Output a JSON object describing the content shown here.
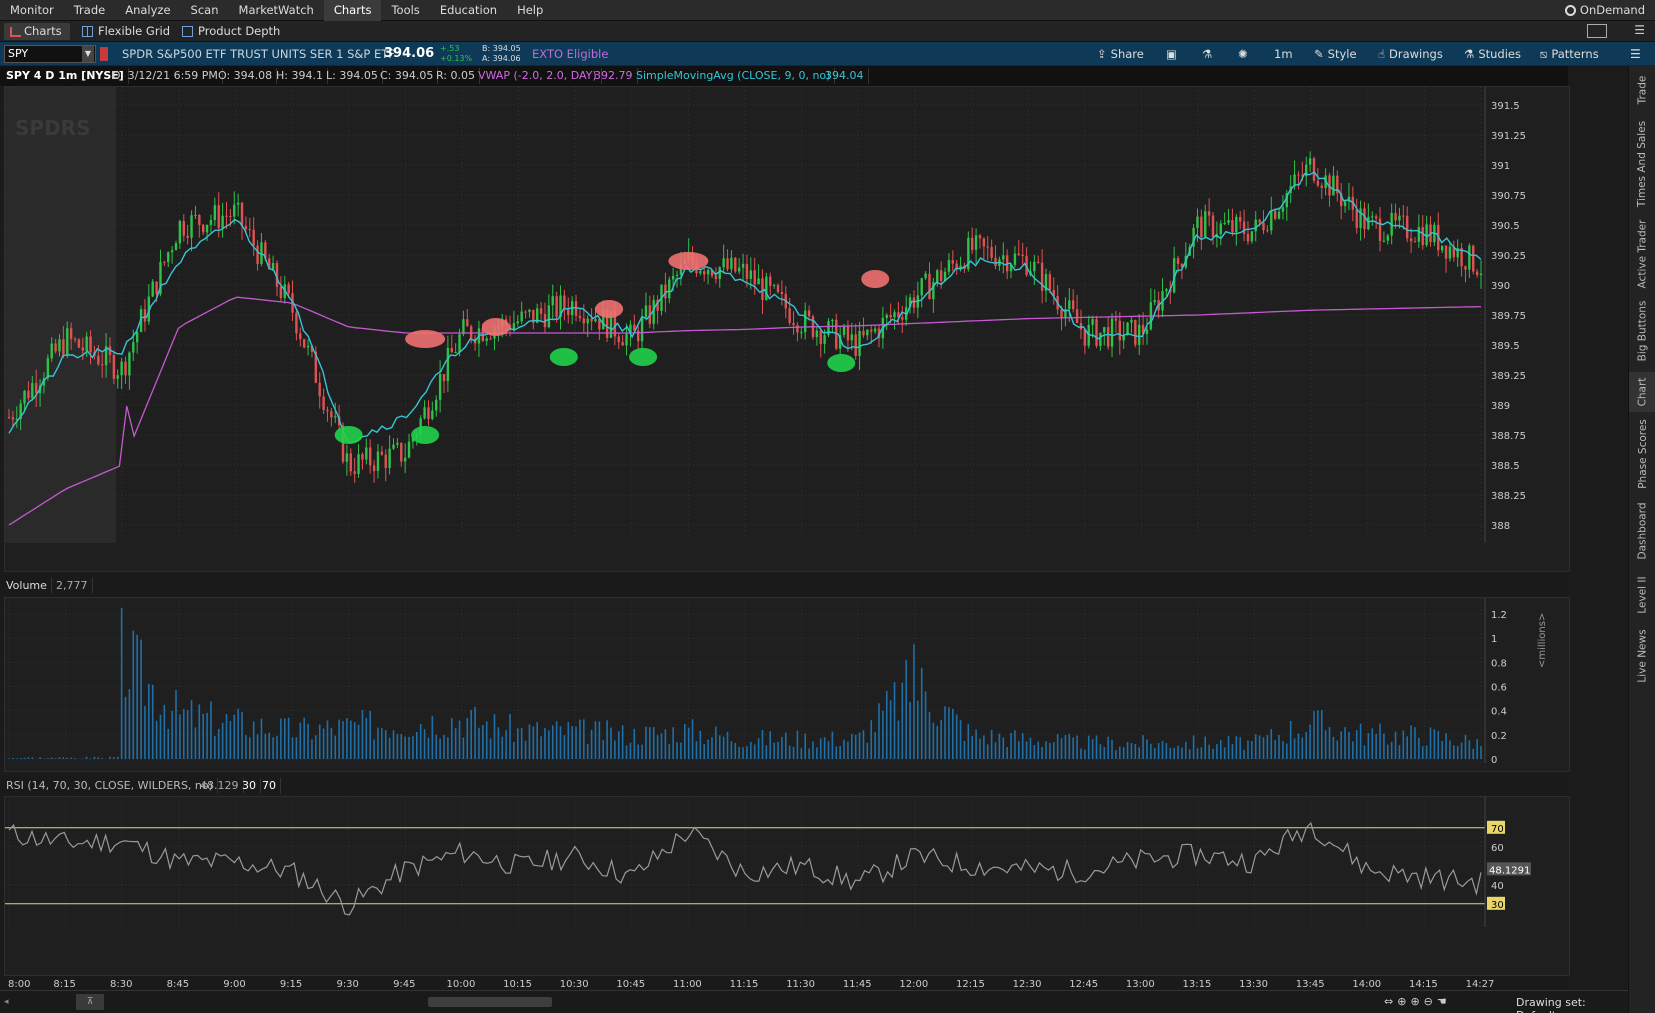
{
  "menu": {
    "items": [
      "Monitor",
      "Trade",
      "Analyze",
      "Scan",
      "MarketWatch",
      "Charts",
      "Tools",
      "Education",
      "Help"
    ],
    "active": "Charts",
    "ondemand": "OnDemand"
  },
  "tabs": {
    "charts": "Charts",
    "flexible_grid": "Flexible Grid",
    "product_depth": "Product Depth"
  },
  "symbol": {
    "ticker": "SPY",
    "description": "SPDR S&P500 ETF TRUST UNITS SER 1 S&P ETF",
    "last": "394.06",
    "change": "+.53",
    "change_pct": "+0.13%",
    "bid": "B: 394.05",
    "ask": "A: 394.06",
    "exto": "EXTO Eligible"
  },
  "toolbar": {
    "share": "Share",
    "timeframe": "1m",
    "style": "Style",
    "drawings": "Drawings",
    "studies": "Studies",
    "patterns": "Patterns"
  },
  "legend": {
    "title": "SPY 4 D 1m [NYSE]",
    "date": "D: 3/12/21 6:59 PM",
    "open": "O: 394.08",
    "high": "H: 394.1",
    "low": "L: 394.05",
    "close": "C: 394.05",
    "range": "R: 0.05",
    "vwap_label": "VWAP (-2.0, 2.0, DAY)",
    "vwap_value": "392.79",
    "sma_label": "SimpleMovingAvg (CLOSE, 9, 0, no)",
    "sma_value": "394.04"
  },
  "watermark": "SPDRS",
  "price_axis": [
    "391.5",
    "391.25",
    "391",
    "390.75",
    "390.5",
    "390.25",
    "390",
    "389.75",
    "389.5",
    "389.25",
    "389",
    "388.75",
    "388.5",
    "388.25",
    "388"
  ],
  "volume": {
    "label": "Volume",
    "value": "2,777",
    "axis": [
      "1.2",
      "1",
      "0.8",
      "0.6",
      "0.4",
      "0.2",
      "0"
    ],
    "unit": "<millions>"
  },
  "rsi": {
    "label": "RSI (14, 70, 30, CLOSE, WILDERS, no)",
    "value": "48.129",
    "low": "30",
    "high": "70",
    "axis": [
      "70",
      "60",
      "48.1291",
      "40",
      "30"
    ]
  },
  "time_axis": [
    "8:00",
    "8:15",
    "8:30",
    "8:45",
    "9:00",
    "9:15",
    "9:30",
    "9:45",
    "10:00",
    "10:15",
    "10:30",
    "10:45",
    "11:00",
    "11:15",
    "11:30",
    "11:45",
    "12:00",
    "12:15",
    "12:30",
    "12:45",
    "13:00",
    "13:15",
    "13:30",
    "13:45",
    "14:00",
    "14:15",
    "14:27"
  ],
  "right_tabs": [
    "Trade",
    "Times And Sales",
    "Active Trader",
    "Big Buttons",
    "Chart",
    "Phase Scores",
    "Dashboard",
    "Level II",
    "Live News"
  ],
  "drawing_set": "Drawing set: Default",
  "colors": {
    "up": "#2ec24a",
    "down": "#e05252",
    "sma": "#35c5d6",
    "vwap": "#c45ad0",
    "volume": "#1f6fa8",
    "rsi": "#9a9a9a",
    "rsi_line": "#e8d66a"
  },
  "chart_data": {
    "type": "candlestick",
    "x": [
      "8:00",
      "8:15",
      "8:30",
      "8:45",
      "9:00",
      "9:15",
      "9:30",
      "9:45",
      "10:00",
      "10:15",
      "10:30",
      "10:45",
      "11:00",
      "11:15",
      "11:30",
      "11:45",
      "12:00",
      "12:15",
      "12:30",
      "12:45",
      "13:00",
      "13:15",
      "13:30",
      "13:45",
      "14:00",
      "14:15",
      "14:27"
    ],
    "close_approx": [
      388.9,
      389.55,
      389.3,
      390.5,
      390.6,
      389.8,
      388.5,
      388.6,
      389.6,
      389.7,
      389.85,
      389.55,
      390.2,
      390.1,
      389.7,
      389.5,
      389.9,
      390.3,
      390.2,
      389.6,
      389.6,
      390.5,
      390.45,
      391.0,
      390.5,
      390.45,
      390.15
    ],
    "sma_approx": [
      388.8,
      389.4,
      389.45,
      390.2,
      390.55,
      389.9,
      388.7,
      388.9,
      389.5,
      389.65,
      389.8,
      389.6,
      390.15,
      390.05,
      389.75,
      389.45,
      389.85,
      390.2,
      390.15,
      389.6,
      389.55,
      390.4,
      390.45,
      390.95,
      390.55,
      390.45,
      390.2
    ],
    "vwap_approx": [
      388.0,
      388.3,
      388.5,
      389.65,
      389.9,
      389.85,
      389.65,
      389.6,
      389.6,
      389.6,
      389.6,
      389.6,
      389.62,
      389.63,
      389.65,
      389.66,
      389.68,
      389.7,
      389.72,
      389.73,
      389.74,
      389.75,
      389.77,
      389.79,
      389.8,
      389.81,
      389.82
    ],
    "volume_millions": [
      0.02,
      0.03,
      1.25,
      0.55,
      0.45,
      0.35,
      0.4,
      0.45,
      0.5,
      0.35,
      0.35,
      0.3,
      0.35,
      0.25,
      0.25,
      0.25,
      0.95,
      0.3,
      0.25,
      0.2,
      0.2,
      0.2,
      0.2,
      0.45,
      0.3,
      0.3,
      0.2
    ],
    "rsi": [
      67,
      62,
      63,
      52,
      52,
      47,
      29,
      48,
      57,
      50,
      55,
      44,
      68,
      46,
      50,
      41,
      55,
      50,
      48,
      47,
      53,
      56,
      52,
      72,
      48,
      44,
      41
    ],
    "ylim": [
      387.9,
      391.6
    ]
  }
}
